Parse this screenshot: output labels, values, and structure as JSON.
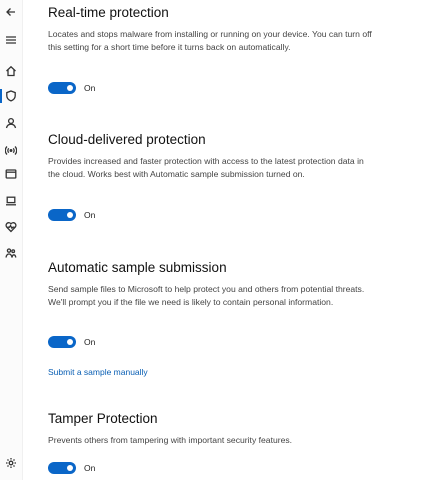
{
  "nav": {
    "icons": [
      "back-arrow-icon",
      "hamburger-menu-icon",
      "home-icon",
      "shield-icon",
      "account-icon",
      "wireless-icon",
      "browser-control-icon",
      "device-security-icon",
      "device-health-icon",
      "family-options-icon",
      "settings-icon"
    ],
    "active_index": 3
  },
  "sections": [
    {
      "title": "Real-time protection",
      "description": "Locates and stops malware from installing or running on your device. You can turn off this setting for a short time before it turns back on automatically.",
      "toggle_state": "On"
    },
    {
      "title": "Cloud-delivered protection",
      "description": "Provides increased and faster protection with access to the latest protection data in the cloud. Works best with Automatic sample submission turned on.",
      "toggle_state": "On"
    },
    {
      "title": "Automatic sample submission",
      "description": "Send sample files to Microsoft to help protect you and others from potential threats. We'll prompt you if the file we need is likely to contain personal information.",
      "toggle_state": "On",
      "link": "Submit a sample manually"
    },
    {
      "title": "Tamper Protection",
      "description": "Prevents others from tampering with important security features.",
      "toggle_state": "On"
    }
  ],
  "colors": {
    "accent": "#0a66c8",
    "link": "#0a5fb4"
  }
}
